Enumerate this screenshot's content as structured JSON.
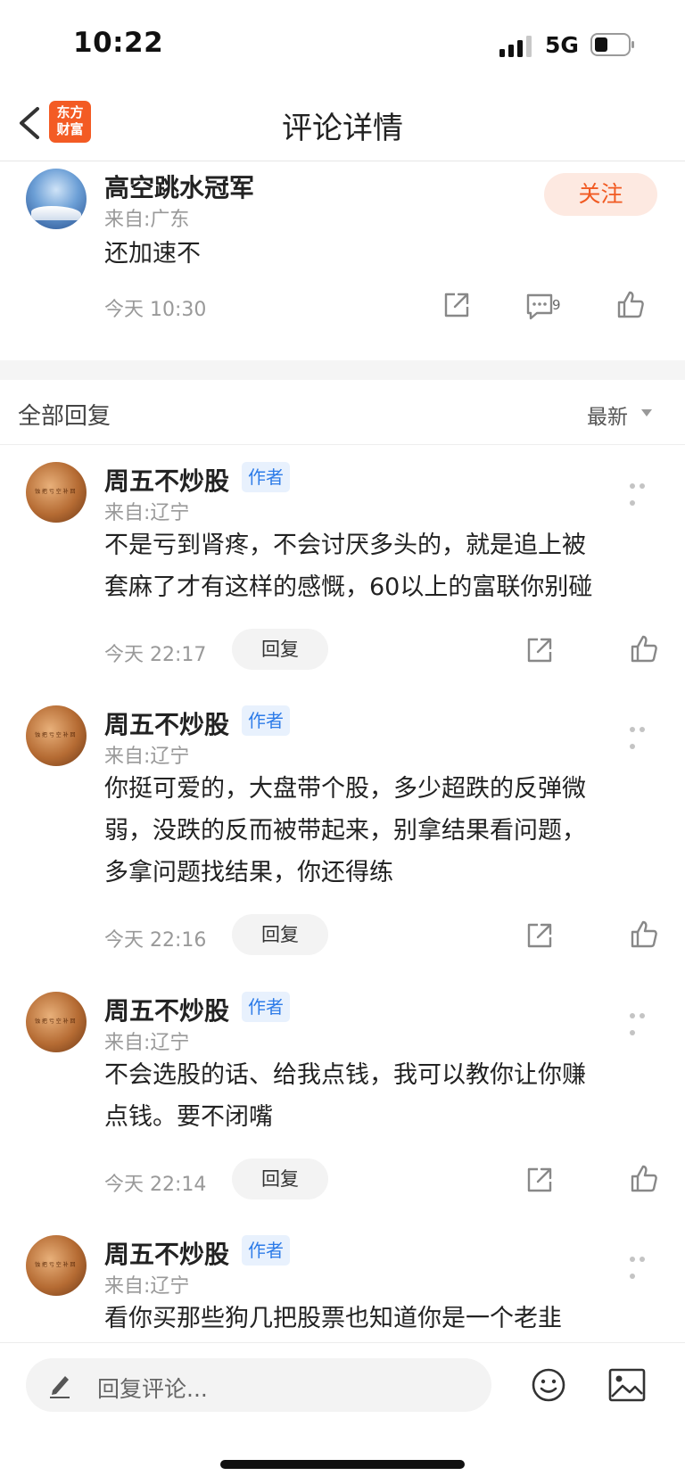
{
  "status_bar": {
    "time": "10:22",
    "network": "5G"
  },
  "nav": {
    "title": "评论详情",
    "logo_line1": "东方",
    "logo_line2": "财富"
  },
  "main_post": {
    "username": "高空跳水冠军",
    "source": "来自:广东",
    "text": "还加速不",
    "follow_label": "关注",
    "time": "今天 10:30",
    "comment_count": "9"
  },
  "replies_header": {
    "label": "全部回复",
    "sort": "最新"
  },
  "replies": [
    {
      "username": "周五不炒股",
      "badge": "作者",
      "source": "来自:辽宁",
      "lines": [
        "不是亏到肾疼，不会讨厌多头的，就是追上被",
        "套麻了才有这样的感慨，60以上的富联你别碰"
      ],
      "time": "今天 22:17",
      "reply_label": "回复"
    },
    {
      "username": "周五不炒股",
      "badge": "作者",
      "source": "来自:辽宁",
      "lines": [
        "你挺可爱的，大盘带个股，多少超跌的反弹微",
        "弱，没跌的反而被带起来，别拿结果看问题，",
        "多拿问题找结果，你还得练"
      ],
      "time": "今天 22:16",
      "reply_label": "回复"
    },
    {
      "username": "周五不炒股",
      "badge": "作者",
      "source": "来自:辽宁",
      "lines": [
        "不会选股的话、给我点钱，我可以教你让你赚",
        "点钱。要不闭嘴"
      ],
      "time": "今天 22:14",
      "reply_label": "回复"
    },
    {
      "username": "周五不炒股",
      "badge": "作者",
      "source": "来自:辽宁",
      "lines": [
        "看你买那些狗几把股票也知道你是一个老韭"
      ]
    }
  ],
  "bottom_bar": {
    "placeholder": "回复评论..."
  },
  "colors": {
    "accent": "#f15a22",
    "badge_blue": "#2e7ce8"
  }
}
